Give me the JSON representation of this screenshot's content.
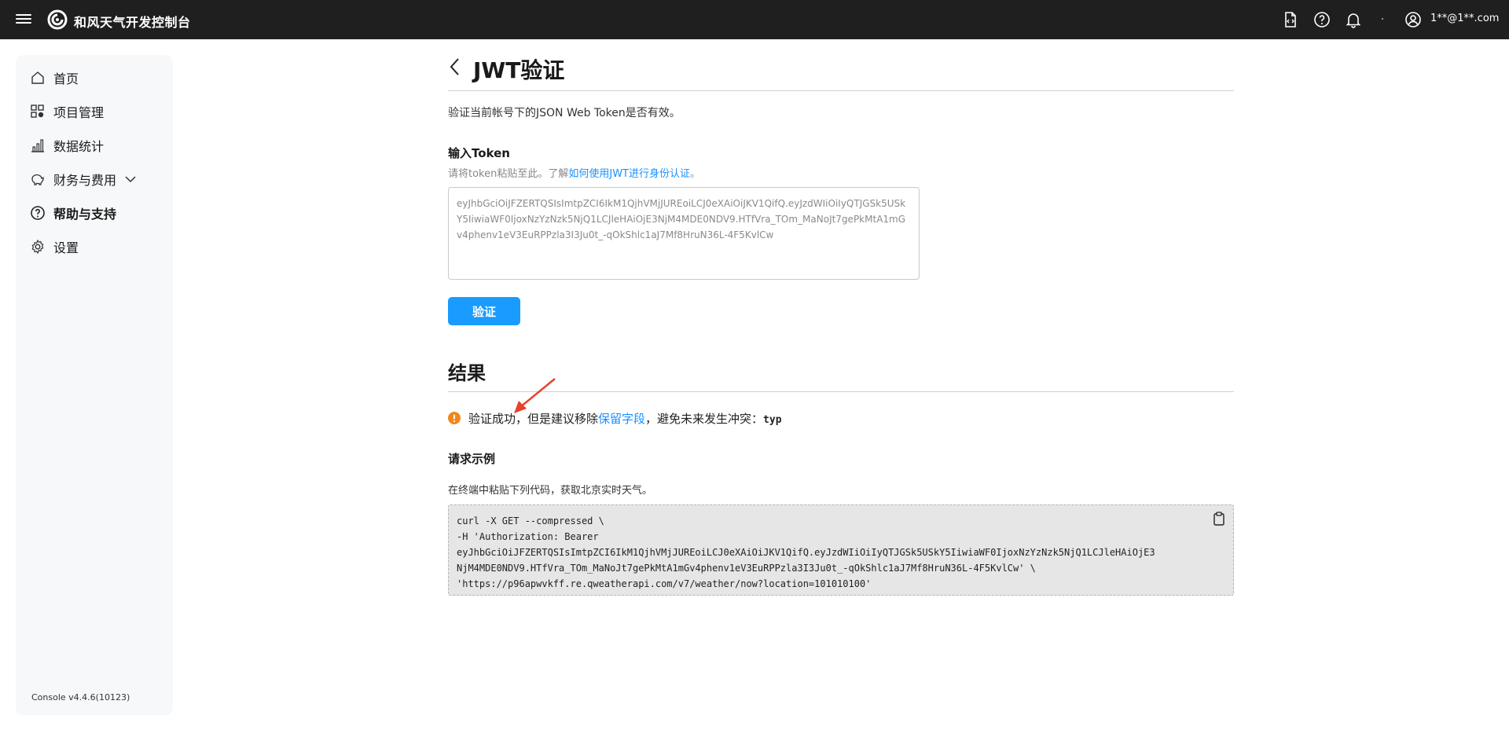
{
  "header": {
    "app_title": "和风天气开发控制台",
    "user": "1**@1**.com",
    "icons": [
      "menu-icon",
      "logo-icon",
      "document-icon",
      "help-icon",
      "bell-icon",
      "user-icon"
    ]
  },
  "sidebar": {
    "items": [
      {
        "label": "首页",
        "icon": "home-icon"
      },
      {
        "label": "项目管理",
        "icon": "grid-icon"
      },
      {
        "label": "数据统计",
        "icon": "bar-chart-icon"
      },
      {
        "label": "财务与费用",
        "icon": "piggy-bank-icon"
      },
      {
        "label": "帮助与支持",
        "icon": "help-circle-icon"
      },
      {
        "label": "设置",
        "icon": "gear-icon"
      }
    ],
    "version": "Console v4.4.6(10123)"
  },
  "main": {
    "title": "JWT验证",
    "description": "验证当前帐号下的JSON Web Token是否有效。",
    "input_label": "输入Token",
    "hint_prefix": "请将token粘贴至此。了解",
    "hint_link": "如何使用JWT进行身份认证",
    "hint_suffix": "。",
    "token_value": "eyJhbGciOiJFZERTQSIsImtpZCI6IkM1QjhVMjJUREoiLCJ0eXAiOiJKV1QifQ.eyJzdWIiOiIyQTJGSk5USkY5IiwiaWF0IjoxNzYzNzk5NjQ1LCJleHAiOjE3NjM4MDE0NDV9.HTfVra_TOm_MaNoJt7gePkMtA1mGv4phenv1eV3EuRPPzla3I3Ju0t_-qOkShlc1aJ7Mf8HruN36L-4F5KvlCw",
    "verify_button": "验证",
    "result_title": "结果",
    "result": {
      "prefix": "验证成功，但是建议移除",
      "link": "保留字段",
      "suffix": "，避免未来发生冲突：",
      "field": "typ"
    },
    "example_title": "请求示例",
    "example_desc": "在终端中粘贴下列代码，获取北京实时天气。",
    "code_lines": [
      "curl -X GET --compressed \\",
      "-H 'Authorization: Bearer",
      "eyJhbGciOiJFZERTQSIsImtpZCI6IkM1QjhVMjJUREoiLCJ0eXAiOiJKV1QifQ.eyJzdWIiOiIyQTJGSk5USkY5IiwiaWF0IjoxNzYzNzk5NjQ1LCJleHAiOjE3",
      "NjM4MDE0NDV9.HTfVra_TOm_MaNoJt7gePkMtA1mGv4phenv1eV3EuRPPzla3I3Ju0t_-qOkShlc1aJ7Mf8HruN36L-4F5KvlCw' \\",
      "'https://p96apwvkff.re.qweatherapi.com/v7/weather/now?location=101010100'"
    ]
  },
  "colors": {
    "accent": "#1a9bff",
    "warning": "#f0881a",
    "header_bg": "#1f1f1f"
  }
}
